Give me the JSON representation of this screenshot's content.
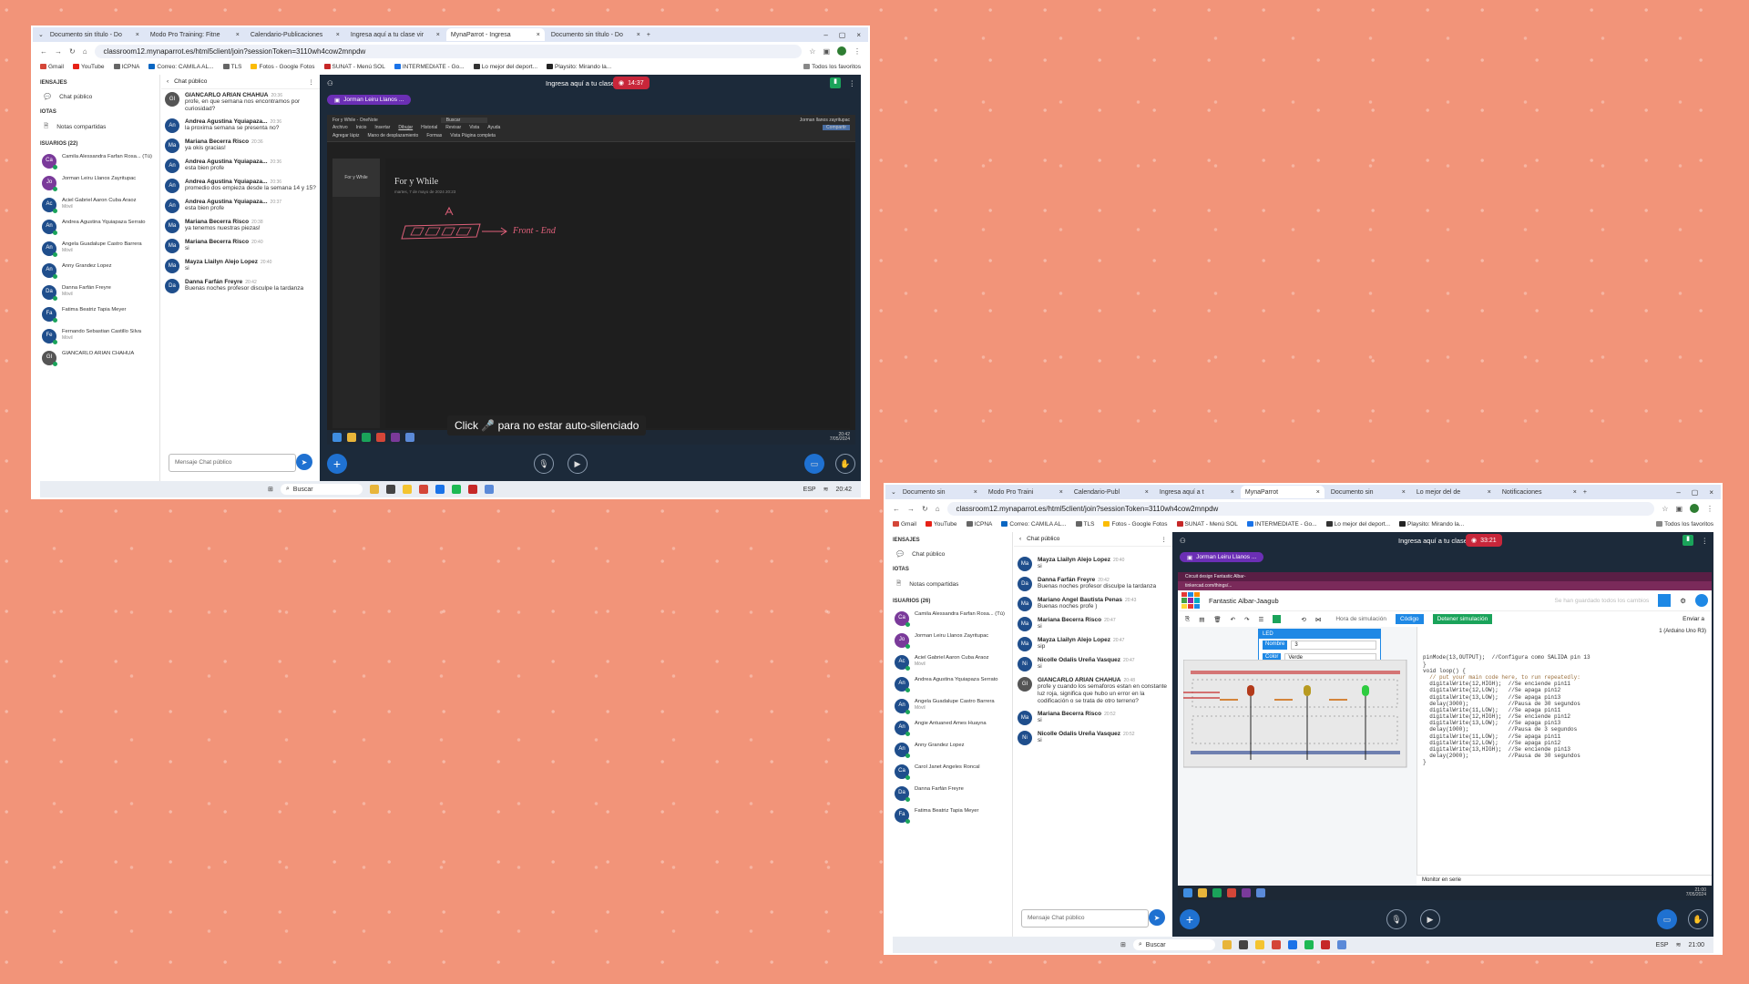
{
  "shot1": {
    "tabs": [
      "Documento sin título - Do",
      "Modo Pro Training: Fitne",
      "Calendario-Publicaciones",
      "Ingresa aquí a tu clase vir",
      "MynaParrot - Ingresa",
      "Documento sin título - Do"
    ],
    "url": "classroom12.mynaparrot.es/html5client/join?sessionToken=3110wh4cow2mnpdw",
    "bookmarks": [
      "Gmail",
      "YouTube",
      "ICPNA",
      "Correo: CAMILA AL...",
      "TLS",
      "Fotos - Google Fotos",
      "SUNAT - Menú SOL",
      "INTERMEDIATE - Go...",
      "Lo mejor del deport...",
      "Playsito: Mirando la..."
    ],
    "all_bookmarks": "Todos los favoritos",
    "left": {
      "mensajes": "IENSAJES",
      "chat_publico": "Chat público",
      "notas": "IOTAS",
      "notas_compartidas": "Notas compartidas",
      "usuarios": "ISUARIOS (22)",
      "users": [
        {
          "initials": "Ca",
          "name": "Camila Alessandra Farfan Rosa... (Tú)",
          "sub": ""
        },
        {
          "initials": "Jo",
          "name": "Jorman Leiru Llanos Zayritupac",
          "sub": ""
        },
        {
          "initials": "Ac",
          "name": "Aciel Gabriel Aaron Cuba Araoz",
          "sub": "Móvil"
        },
        {
          "initials": "An",
          "name": "Andrea Agustina Yquiapaza Serrato",
          "sub": ""
        },
        {
          "initials": "An",
          "name": "Angela Guadalupe Castro Barrera",
          "sub": "Móvil"
        },
        {
          "initials": "An",
          "name": "Anny Grandez Lopez",
          "sub": ""
        },
        {
          "initials": "Da",
          "name": "Danna Farfán Freyre",
          "sub": "Móvil"
        },
        {
          "initials": "Fa",
          "name": "Fatima Beatriz Tapia Meyer",
          "sub": ""
        },
        {
          "initials": "Fe",
          "name": "Fernando Sebastian Castillo Silva",
          "sub": "Móvil"
        },
        {
          "initials": "GI",
          "name": "GIANCARLO ARIAN CHAHUA",
          "sub": ""
        }
      ]
    },
    "chat": {
      "title": "Chat público",
      "messages": [
        {
          "initials": "GI",
          "name": "GIANCARLO ARIAN CHAHUA",
          "time": "20:36",
          "text": "profe, en que semana nos encontramos por curiosidad?"
        },
        {
          "initials": "An",
          "name": "Andrea Agustina Yquiapaza...",
          "time": "20:36",
          "text": "la proxima semana se presenta no?"
        },
        {
          "initials": "Ma",
          "name": "Mariana Becerra Risco",
          "time": "20:36",
          "text": "ya okis gracias!"
        },
        {
          "initials": "An",
          "name": "Andrea Agustina Yquiapaza...",
          "time": "20:36",
          "text": "esta bien profe"
        },
        {
          "initials": "An",
          "name": "Andrea Agustina Yquiapaza...",
          "time": "20:36",
          "text": "promedio dos empieza desde la semana 14 y 15?"
        },
        {
          "initials": "An",
          "name": "Andrea Agustina Yquiapaza...",
          "time": "20:37",
          "text": "esta bien profe"
        },
        {
          "initials": "Ma",
          "name": "Mariana Becerra Risco",
          "time": "20:38",
          "text": "ya tenemos nuestras piezas!"
        },
        {
          "initials": "Ma",
          "name": "Mariana Becerra Risco",
          "time": "20:40",
          "text": "si"
        },
        {
          "initials": "Ma",
          "name": "Mayza Llailyn Alejo Lopez",
          "time": "20:40",
          "text": "si"
        },
        {
          "initials": "Da",
          "name": "Danna Farfán Freyre",
          "time": "20:42",
          "text": "Buenas noches profesor disculpe la tardanza"
        }
      ],
      "placeholder": "Mensaje Chat público"
    },
    "stage": {
      "title": "Ingresa aquí a tu clase virtual",
      "rec_time": "14:37",
      "presenter": "Jorman Leiru Llanos ...",
      "onenote_title": "For y While - OneNote",
      "menus": [
        "Archivo",
        "Inicio",
        "Insertar",
        "Dibujar",
        "Historial",
        "Revisar",
        "Vista",
        "Ayuda"
      ],
      "tools": [
        "Agregar lápiz",
        "Mano de desplazamiento",
        "Formas",
        "Vista Página completa"
      ],
      "share": "Compartir",
      "search": "Buscar",
      "user_name": "Jorman llanos zayritupac",
      "section": "For y While",
      "page_title": "For y While",
      "page_date": "martes, 7 de mayo de 2024     20:23",
      "ink_text": "Front - End",
      "toast": "Click 🎤 para no estar auto-silenciado",
      "clock": "20:42",
      "date": "7/05/2024"
    },
    "win_taskbar": {
      "search": "Buscar",
      "lang": "ESP",
      "clock": "20:42"
    }
  },
  "shot2": {
    "tabs": [
      "Documento sin",
      "Modo Pro Traini",
      "Calendario-Publ",
      "Ingresa aquí a t",
      "MynaParrot",
      "Documento sin",
      "Lo mejor del de",
      "Notificaciones"
    ],
    "url": "classroom12.mynaparrot.es/html5client/join?sessionToken=3110wh4cow2mnpdw",
    "bookmarks": [
      "Gmail",
      "YouTube",
      "ICPNA",
      "Correo: CAMILA AL...",
      "TLS",
      "Fotos - Google Fotos",
      "SUNAT - Menú SOL",
      "INTERMEDIATE - Go...",
      "Lo mejor del deport...",
      "Playsito: Mirando la..."
    ],
    "all_bookmarks": "Todos los favoritos",
    "left": {
      "mensajes": "IENSAJES",
      "chat_publico": "Chat público",
      "notas": "IOTAS",
      "notas_compartidas": "Notas compartidas",
      "usuarios": "ISUARIOS (26)",
      "users": [
        {
          "initials": "Ca",
          "name": "Camila Alessandra Farfan Rosa... (Tú)",
          "sub": ""
        },
        {
          "initials": "Jo",
          "name": "Jorman Leiru Llanos Zayritupac",
          "sub": ""
        },
        {
          "initials": "Ac",
          "name": "Aciel Gabriel Aaron Cuba Araoz",
          "sub": "Móvil"
        },
        {
          "initials": "An",
          "name": "Andrea Agustina Yquiapaza Serrato",
          "sub": ""
        },
        {
          "initials": "An",
          "name": "Angela Guadalupe Castro Barrera",
          "sub": "Móvil"
        },
        {
          "initials": "An",
          "name": "Angie Antuaned Ames Huayna",
          "sub": ""
        },
        {
          "initials": "An",
          "name": "Anny Grandez Lopez",
          "sub": ""
        },
        {
          "initials": "Ca",
          "name": "Carol Janet Angeles Roncal",
          "sub": ""
        },
        {
          "initials": "Da",
          "name": "Danna Farfán Freyre",
          "sub": ""
        },
        {
          "initials": "Fa",
          "name": "Fatima Beatriz Tapia Meyer",
          "sub": ""
        }
      ]
    },
    "chat": {
      "title": "Chat público",
      "messages": [
        {
          "initials": "Ma",
          "name": "Mayza Llailyn Alejo Lopez",
          "time": "20:40",
          "text": "si"
        },
        {
          "initials": "Da",
          "name": "Danna Farfán Freyre",
          "time": "20:42",
          "text": "Buenas noches profesor disculpe la tardanza"
        },
        {
          "initials": "Ma",
          "name": "Mariano Angel Bautista Penas",
          "time": "20:43",
          "text": "Buenas noches profe )"
        },
        {
          "initials": "Ma",
          "name": "Mariana Becerra Risco",
          "time": "20:47",
          "text": "si"
        },
        {
          "initials": "Ma",
          "name": "Mayza Llailyn Alejo Lopez",
          "time": "20:47",
          "text": "sip"
        },
        {
          "initials": "Ni",
          "name": "Nicolle Odalis Ureña Vasquez",
          "time": "20:47",
          "text": "si"
        },
        {
          "initials": "GI",
          "name": "GIANCARLO ARIAN CHAHUA",
          "time": "20:48",
          "text": "profe y cuando los semaforos estan en constante luz roja, significa que hubo un error en la codificación o se trata de otro terreno?"
        },
        {
          "initials": "Ma",
          "name": "Mariana Becerra Risco",
          "time": "20:52",
          "text": "si"
        },
        {
          "initials": "Ni",
          "name": "Nicolle Odalis Ureña Vasquez",
          "time": "20:52",
          "text": "si"
        }
      ],
      "placeholder": "Mensaje Chat público"
    },
    "stage": {
      "title": "Ingresa aquí a tu clase virtual",
      "rec_time": "33:21",
      "presenter": "Jorman Leiru Llanos ...",
      "inner_tab": "Circuit design Fantastic Albar-",
      "inner_url": "tinkercad.com/things/...",
      "project": "Fantastic Albar-Jaagub",
      "saved": "Se han guardado todos los cambios",
      "sim_time": "Hora de simulación",
      "code_btn": "Código",
      "stop_btn": "Detener simulación",
      "send_btn": "Enviar a",
      "board": "1 (Arduino Uno R3)",
      "led_panel": {
        "title": "LED",
        "name_label": "Nombre",
        "name_value": "3",
        "color_label": "Color",
        "color_value": "Verde"
      },
      "code_lines": [
        "pinMode(13,OUTPUT);  //Configura como SALIDA pin 13",
        "}",
        "",
        "void loop() {",
        "  // put your main code here, to run repeatedly:",
        "  digitalWrite(12,HIGH);  //Se enciende pin11",
        "  digitalWrite(12,LOW);   //Se apaga pin12",
        "  digitalWrite(13,LOW);   //Se apaga pin13",
        "  delay(3000);            //Pausa de 30 segundos",
        "",
        "  digitalWrite(11,LOW);   //Se apaga pin11",
        "  digitalWrite(12,HIGH);  //Se enciende pin12",
        "  digitalWrite(13,LOW);   //Se apaga pin13",
        "  delay(1000);            //Pausa de 3 segundos",
        "",
        "  digitalWrite(11,LOW);   //Se apaga pin11",
        "  digitalWrite(12,LOW);   //Se apaga pin12",
        "  digitalWrite(13,HIGH);  //Se enciende pin13",
        "  delay(2000);            //Pausa de 30 segundos",
        "}"
      ],
      "serial": "Monitor en serie",
      "clock": "21:00",
      "date": "7/05/2024"
    },
    "win_taskbar": {
      "search": "Buscar",
      "lang": "ESP",
      "clock": "21:00"
    }
  },
  "colors": {
    "accent": "#1f71d1",
    "rec": "#c8263a",
    "presenter": "#6b2fb5",
    "avatar": "#1f4e8c",
    "background": "#f29479"
  }
}
